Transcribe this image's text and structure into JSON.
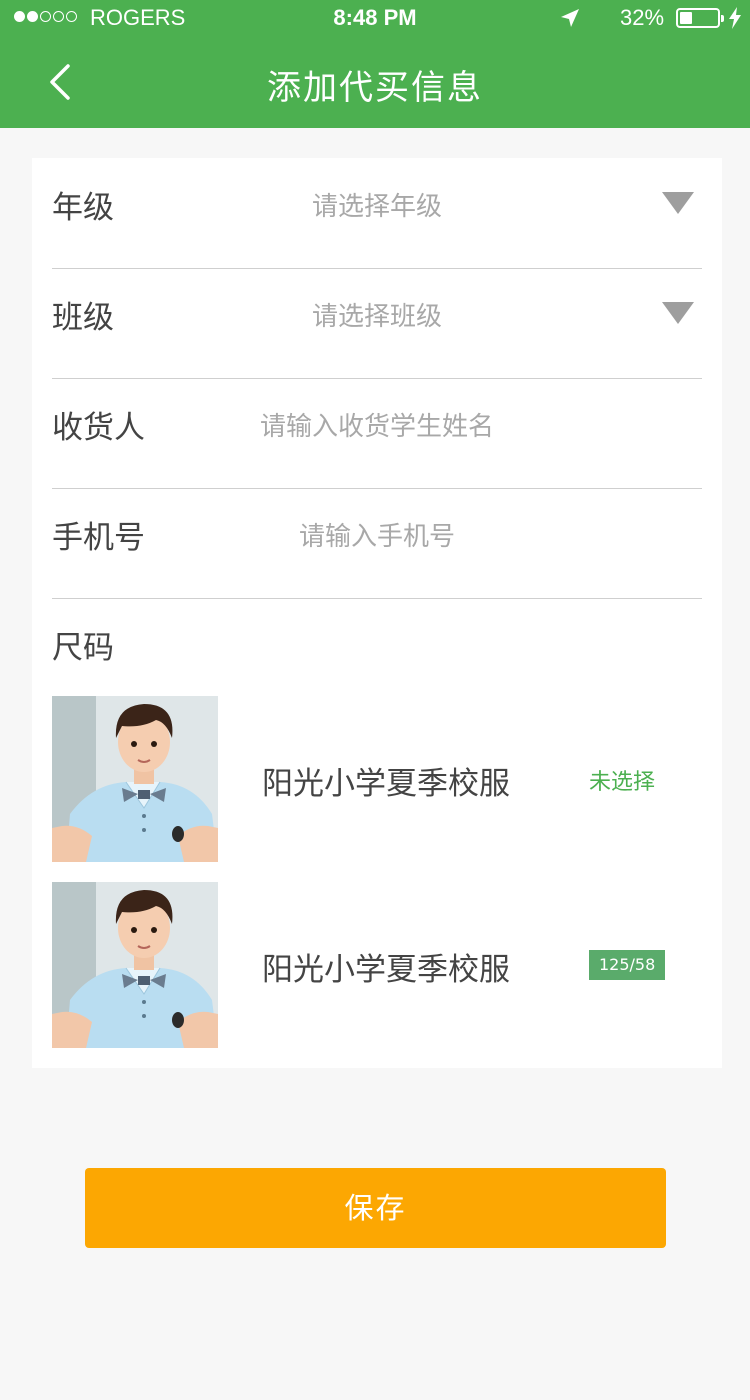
{
  "status_bar": {
    "carrier": "ROGERS",
    "time": "8:48 PM",
    "battery": "32%",
    "battery_level": 0.32,
    "signal_bars": 2,
    "signal_total": 5
  },
  "header": {
    "title": "添加代买信息",
    "back_icon": "chevron-left-icon",
    "background": "#4cb050"
  },
  "form": {
    "grade": {
      "label": "年级",
      "placeholder": "请选择年级"
    },
    "class": {
      "label": "班级",
      "placeholder": "请选择班级"
    },
    "receiver": {
      "label": "收货人",
      "placeholder": "请输入收货学生姓名"
    },
    "phone": {
      "label": "手机号",
      "placeholder": "请输入手机号"
    },
    "size_label": "尺码"
  },
  "products": [
    {
      "name": "阳光小学夏季校服",
      "status": "未选择"
    },
    {
      "name": "阳光小学夏季校服",
      "size": "125/58"
    }
  ],
  "save_label": "保存",
  "colors": {
    "accent": "#4cb050",
    "button": "#fca702",
    "badge": "#5aab6b"
  }
}
